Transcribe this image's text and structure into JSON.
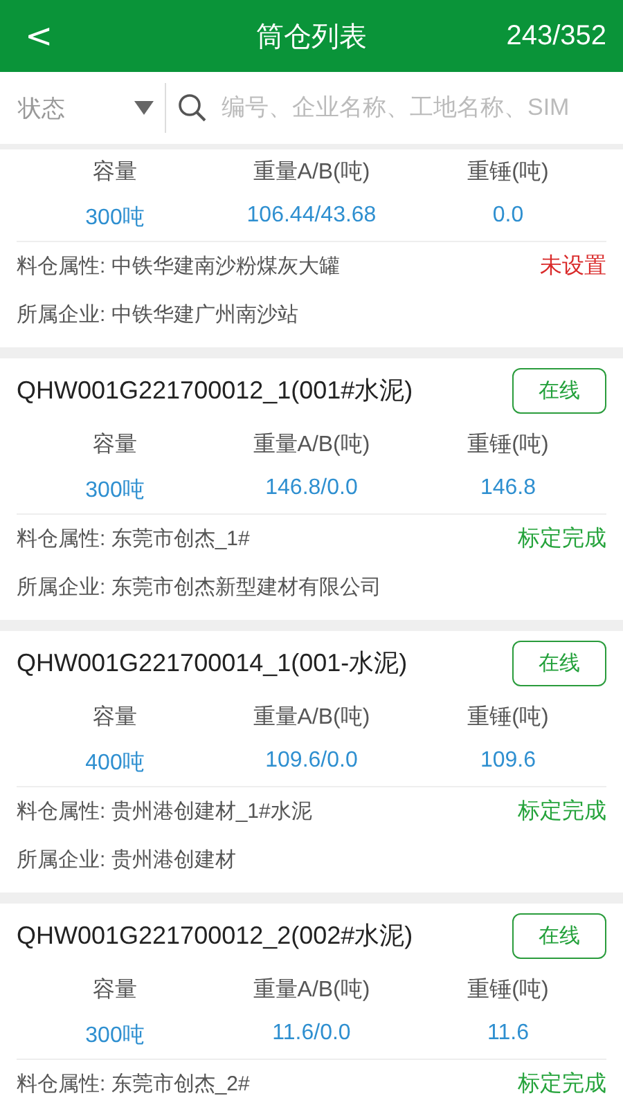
{
  "header": {
    "back": "<",
    "title": "筒仓列表",
    "count": "243/352"
  },
  "filter": {
    "status": "状态",
    "search_placeholder": "编号、企业名称、工地名称、SIM"
  },
  "cards": [
    {
      "stats": [
        {
          "label": "容量",
          "value": "300吨"
        },
        {
          "label": "重量A/B(吨)",
          "value": "106.44/43.68"
        },
        {
          "label": "重锤(吨)",
          "value": "0.0"
        }
      ],
      "attribute_label": "料仓属性:",
      "attribute": "中铁华建南沙粉煤灰大罐",
      "calibration": {
        "text": "未设置",
        "kind": "unset"
      },
      "company_label": "所属企业:",
      "company": "中铁华建广州南沙站"
    },
    {
      "title": "QHW001G221700012_1(001#水泥)",
      "badge": "在线",
      "stats": [
        {
          "label": "容量",
          "value": "300吨"
        },
        {
          "label": "重量A/B(吨)",
          "value": "146.8/0.0"
        },
        {
          "label": "重锤(吨)",
          "value": "146.8"
        }
      ],
      "attribute_label": "料仓属性:",
      "attribute": "东莞市创杰_1#",
      "calibration": {
        "text": "标定完成",
        "kind": "done"
      },
      "company_label": "所属企业:",
      "company": "东莞市创杰新型建材有限公司"
    },
    {
      "title": "QHW001G221700014_1(001-水泥)",
      "badge": "在线",
      "stats": [
        {
          "label": "容量",
          "value": "400吨"
        },
        {
          "label": "重量A/B(吨)",
          "value": "109.6/0.0"
        },
        {
          "label": "重锤(吨)",
          "value": "109.6"
        }
      ],
      "attribute_label": "料仓属性:",
      "attribute": "贵州港创建材_1#水泥",
      "calibration": {
        "text": "标定完成",
        "kind": "done"
      },
      "company_label": "所属企业:",
      "company": "贵州港创建材"
    },
    {
      "title": "QHW001G221700012_2(002#水泥)",
      "badge": "在线",
      "stats": [
        {
          "label": "容量",
          "value": "300吨"
        },
        {
          "label": "重量A/B(吨)",
          "value": "11.6/0.0"
        },
        {
          "label": "重锤(吨)",
          "value": "11.6"
        }
      ],
      "attribute_label": "料仓属性:",
      "attribute": "东莞市创杰_2#",
      "calibration": {
        "text": "标定完成",
        "kind": "done"
      }
    }
  ]
}
